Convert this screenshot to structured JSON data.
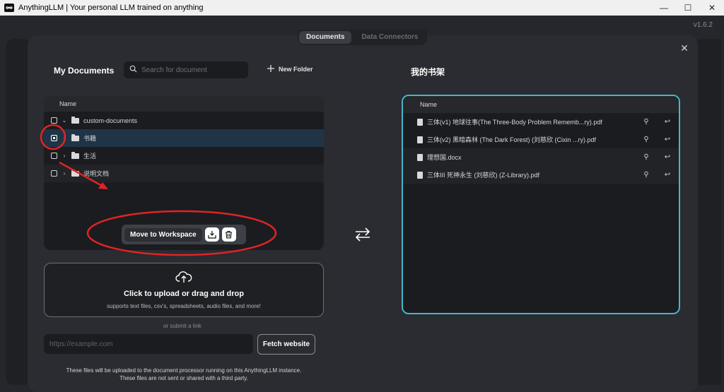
{
  "window": {
    "title": "AnythingLLM | Your personal LLM trained on anything",
    "minimize": "—",
    "maximize": "☐",
    "close": "✕"
  },
  "version": "v1.6.2",
  "tabs": [
    {
      "label": "Documents",
      "active": true
    },
    {
      "label": "Data Connectors",
      "active": false
    }
  ],
  "my_documents": {
    "heading": "My Documents",
    "search_placeholder": "Search for document",
    "new_folder_label": "New Folder",
    "column_name": "Name",
    "rows": [
      {
        "name": "custom-documents",
        "checked": false,
        "expanded": true
      },
      {
        "name": "书籍",
        "checked": true,
        "expanded": false
      },
      {
        "name": "生活",
        "checked": false,
        "expanded": false
      },
      {
        "name": "说明文档",
        "checked": false,
        "expanded": false
      }
    ],
    "move_to_workspace_label": "Move to Workspace"
  },
  "upload": {
    "title": "Click to upload or drag and drop",
    "subtitle": "supports text files, csv's, spreadsheets, audio files, and more!",
    "or_submit": "or submit a link",
    "url_placeholder": "https://example.com",
    "fetch_label": "Fetch website",
    "footnote_line1": "These files will be uploaded to the document processor running on this AnythingLLM instance.",
    "footnote_line2": "These files are not sent or shared with a third party."
  },
  "workspace": {
    "heading": "我的书架",
    "column_name": "Name",
    "files": [
      {
        "name": "三体(v1) 地球往事(The Three-Body Problem Rememb...ry).pdf"
      },
      {
        "name": "三体(v2) 黑暗森林 (The Dark Forest) (刘慈欣 (Cixin ...ry).pdf"
      },
      {
        "name": "理想国.docx"
      },
      {
        "name": "三体III 死神永生 (刘慈欣) (Z-Library).pdf"
      }
    ]
  },
  "colors": {
    "accent": "#46b6c9",
    "annotation": "#e02424",
    "selected_row": "#1f3447"
  }
}
